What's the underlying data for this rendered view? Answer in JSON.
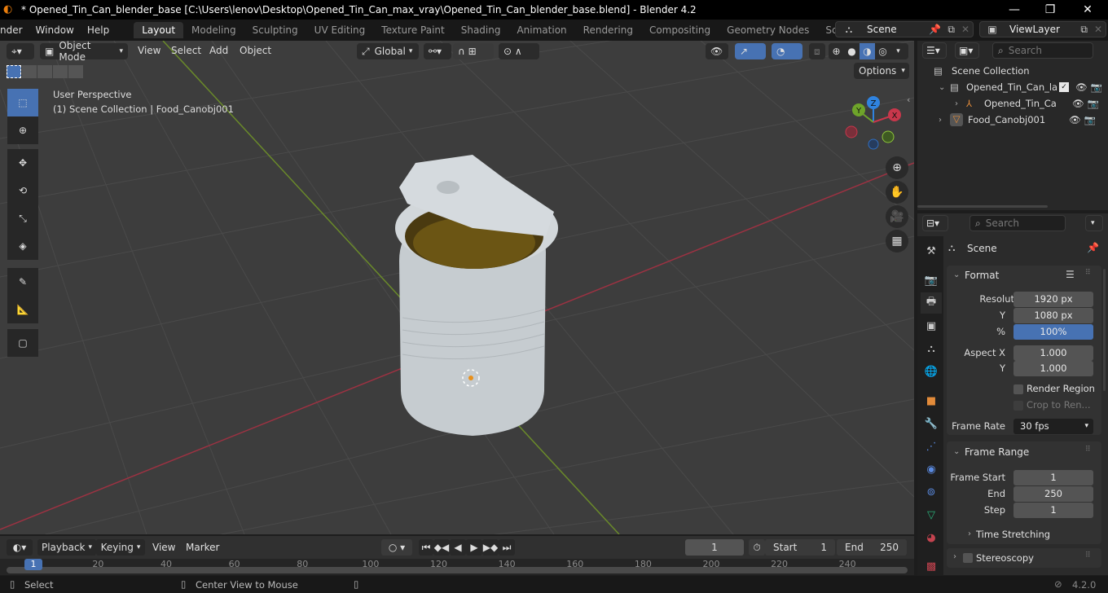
{
  "window": {
    "title": "* Opened_Tin_Can_blender_base [C:\\Users\\lenov\\Desktop\\Opened_Tin_Can_max_vray\\Opened_Tin_Can_blender_base.blend] - Blender 4.2",
    "minimize": "—",
    "maximize": "❐",
    "close": "✕"
  },
  "menubar": {
    "items": [
      "nder",
      "Window",
      "Help"
    ],
    "workspaces": [
      "Layout",
      "Modeling",
      "Sculpting",
      "UV Editing",
      "Texture Paint",
      "Shading",
      "Animation",
      "Rendering",
      "Compositing",
      "Geometry Nodes",
      "Scripting"
    ],
    "active_workspace": "Layout",
    "add_workspace": "+",
    "scene": "Scene",
    "view_layer": "ViewLayer"
  },
  "viewport": {
    "mode": "Object Mode",
    "menus": [
      "View",
      "Select",
      "Add",
      "Object"
    ],
    "transform_orientation": "Global",
    "options_label": "Options",
    "overlay_line1": "User Perspective",
    "overlay_line2": "(1) Scene Collection | Food_Canobj001",
    "gizmo": {
      "x": "X",
      "y": "Y",
      "z": "Z"
    },
    "tools": [
      "select-box",
      "cursor",
      "move",
      "rotate",
      "scale",
      "transform",
      "annotate",
      "measure",
      "add-cube"
    ],
    "active_tool": "select-box",
    "colors": {
      "accent": "#4772b3",
      "x_axis": "#c8374b",
      "y_axis": "#6ea42a",
      "z_axis": "#2f83e0"
    }
  },
  "outliner": {
    "search_placeholder": "Search",
    "root": "Scene Collection",
    "items": [
      {
        "name": "Opened_Tin_Can_la",
        "type": "collection",
        "expanded": true,
        "checked": true
      },
      {
        "name": "Opened_Tin_Ca",
        "type": "empty",
        "expanded": false
      },
      {
        "name": "Food_Canobj001",
        "type": "mesh",
        "expanded": false
      }
    ]
  },
  "properties": {
    "search_placeholder": "Search",
    "context": "Scene",
    "format": {
      "title": "Format",
      "resolution_label": "Resolutio...",
      "resolution_x": "1920 px",
      "y_label": "Y",
      "resolution_y": "1080 px",
      "percent_label": "%",
      "resolution_percent": "100%",
      "aspect_x_label": "Aspect X",
      "aspect_x": "1.000",
      "aspect_y_label": "Y",
      "aspect_y": "1.000",
      "render_region": "Render Region",
      "crop_to_render": "Crop to Ren...",
      "frame_rate_label": "Frame Rate",
      "frame_rate": "30 fps"
    },
    "frame_range": {
      "title": "Frame Range",
      "start_label": "Frame Start",
      "start": "1",
      "end_label": "End",
      "end": "250",
      "step_label": "Step",
      "step": "1",
      "time_stretching": "Time Stretching"
    },
    "stereoscopy": "Stereoscopy"
  },
  "timeline": {
    "menus": [
      "Playback",
      "Keying",
      "View",
      "Marker"
    ],
    "current_frame": "1",
    "start_label": "Start",
    "start": "1",
    "end_label": "End",
    "end": "250",
    "ruler": [
      "20",
      "40",
      "60",
      "80",
      "100",
      "120",
      "140",
      "160",
      "180",
      "200",
      "220",
      "240"
    ],
    "playhead": "1"
  },
  "statusbar": {
    "select": "Select",
    "center_view": "Center View to Mouse",
    "version": "4.2.0"
  }
}
